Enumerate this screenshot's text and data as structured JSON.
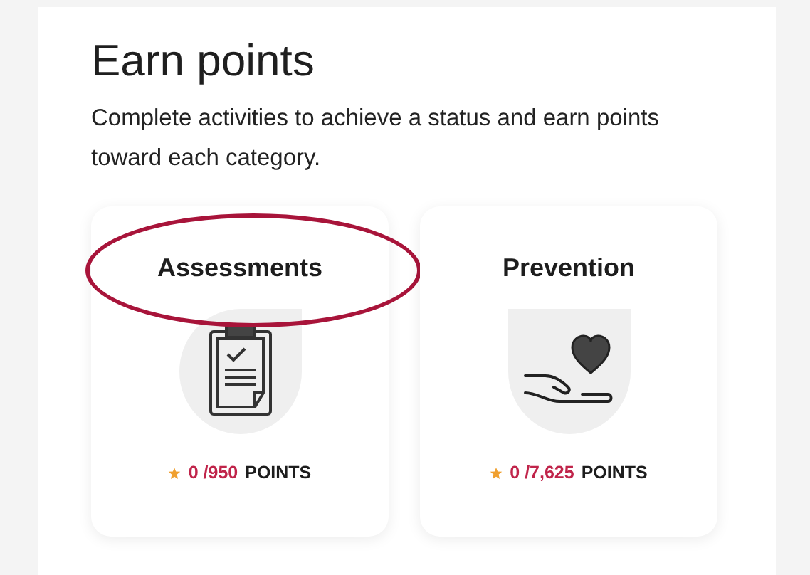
{
  "heading": "Earn points",
  "description": "Complete activities to achieve a status and earn points toward each category.",
  "categories": [
    {
      "title": "Assessments",
      "kind": "clipboard",
      "highlighted": true,
      "earned": "0",
      "total": "/950",
      "unit": "POINTS"
    },
    {
      "title": "Prevention",
      "kind": "heart-hand",
      "highlighted": false,
      "earned": "0",
      "total": "/7,625",
      "unit": "POINTS"
    }
  ]
}
